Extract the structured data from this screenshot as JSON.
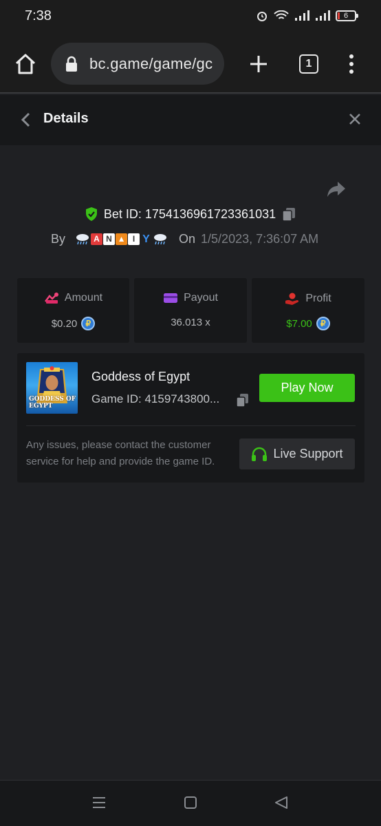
{
  "status_bar": {
    "time": "7:38",
    "battery": "6"
  },
  "browser": {
    "url": "bc.game/game/gc",
    "tab_count": "1"
  },
  "header": {
    "title": "Details"
  },
  "bet": {
    "id_label": "Bet ID: 1754136961723361031",
    "by_label": "By",
    "username_letters": [
      "A",
      "N",
      "▲",
      "I",
      "Y"
    ],
    "on_label": "On",
    "date": "1/5/2023, 7:36:07 AM"
  },
  "stats": {
    "amount": {
      "label": "Amount",
      "value": "$0.20"
    },
    "payout": {
      "label": "Payout",
      "value": "36.013 x"
    },
    "profit": {
      "label": "Profit",
      "value": "$7.00"
    }
  },
  "game": {
    "name": "Goddess of Egypt",
    "id": "Game ID: 4159743800...",
    "thumb_title_line1": "GODDESS OF",
    "thumb_title_line2": "EGYPT",
    "play_label": "Play Now",
    "issue_text": "Any issues, please contact the customer service for help and provide the game ID.",
    "support_label": "Live Support"
  },
  "colors": {
    "accent_green": "#3bc117",
    "profit_green": "#3bc117",
    "background": "#1f2023",
    "card": "#17181a"
  }
}
